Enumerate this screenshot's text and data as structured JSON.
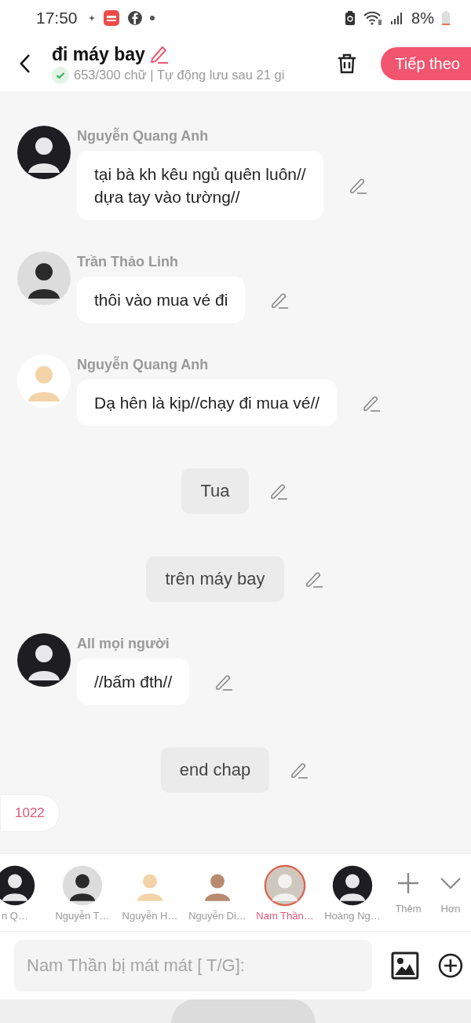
{
  "status_bar": {
    "time": "17:50",
    "battery": "8%"
  },
  "header": {
    "title": "đi máy bay",
    "subtitle": "653/300 chữ | Tự động lưu sau 21 gi",
    "next_button": "Tiếp theo"
  },
  "messages": [
    {
      "kind": "character",
      "name": "Nguyễn Quang Anh",
      "text": "tại bà kh kêu ngủ quên luôn//\ndựa tay vào tường//"
    },
    {
      "kind": "character",
      "name": "Trần Thảo Linh",
      "text": "thôi vào mua vé đi"
    },
    {
      "kind": "character",
      "name": "Nguyễn Quang Anh",
      "text": "Dạ hên là kịp//chạy đi mua vé//"
    },
    {
      "kind": "narration",
      "text": "Tua"
    },
    {
      "kind": "narration",
      "text": "trên máy bay"
    },
    {
      "kind": "character",
      "name": "All mọi người",
      "text": "//bấm đth//"
    },
    {
      "kind": "narration",
      "text": "end chap"
    }
  ],
  "counter_badge": "1022",
  "characters": [
    {
      "label": "n Q…",
      "selected": false
    },
    {
      "label": "Nguyễn T…",
      "selected": false
    },
    {
      "label": "Nguyễn H…",
      "selected": false
    },
    {
      "label": "Nguyễn Di…",
      "selected": false
    },
    {
      "label": "Nam Thần…",
      "selected": true
    },
    {
      "label": "Hoàng Ng…",
      "selected": false
    }
  ],
  "add_label": "Thêm",
  "more_label": "Hơn",
  "input": {
    "placeholder": "Nam Thần bị mát mát [ T/G]:"
  }
}
